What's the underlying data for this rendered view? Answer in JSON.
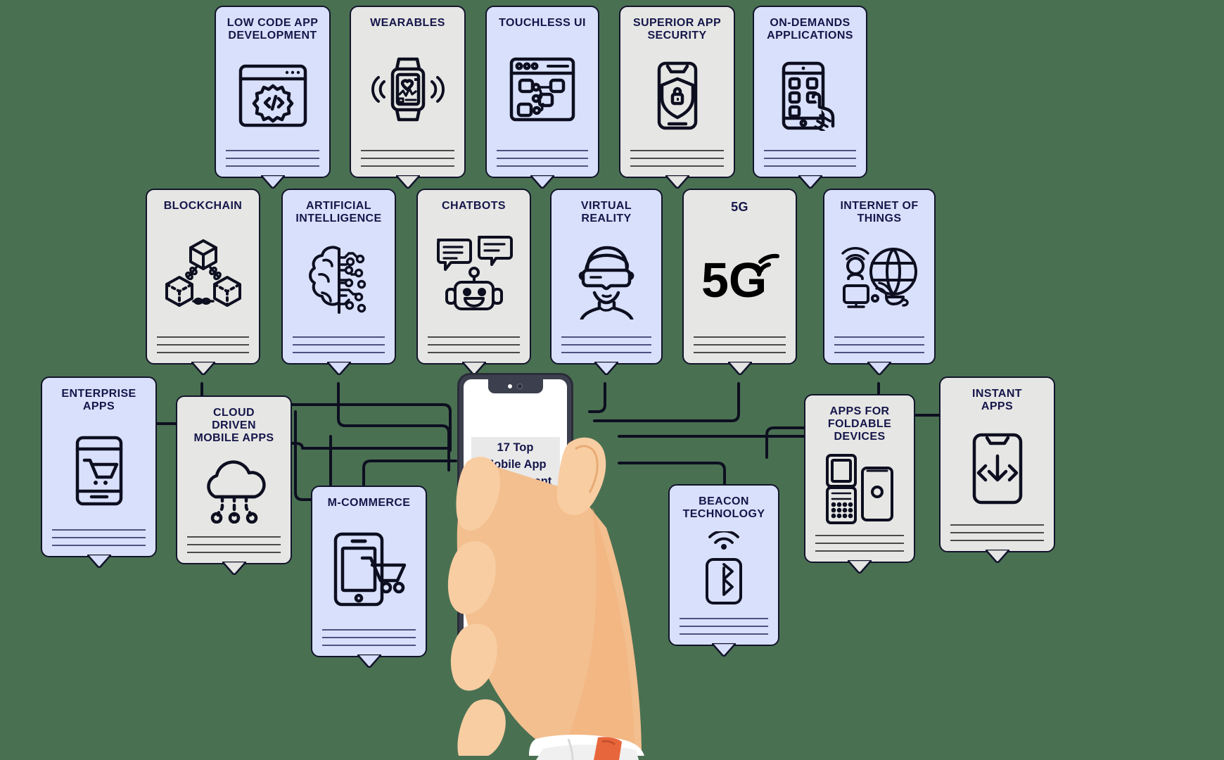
{
  "meta": {
    "background_color": "#4a7052",
    "card_blue": "#d9e0fb",
    "card_grey": "#e6e6e4",
    "title_color": "#15164a",
    "outline_color": "#12142b"
  },
  "phone": {
    "headline": "17 Top\nMobile App\nDevelopment\nTrends To\nLook Out For\nIn 2024"
  },
  "cards": [
    {
      "id": "low-code-app-development",
      "label": "LOW CODE APP\nDEVELOPMENT",
      "theme": "blue",
      "icon": "code-window-icon"
    },
    {
      "id": "wearables",
      "label": "WEARABLES",
      "theme": "grey",
      "icon": "smartwatch-icon"
    },
    {
      "id": "touchless-ui",
      "label": "TOUCHLESS UI",
      "theme": "blue",
      "icon": "flow-window-icon"
    },
    {
      "id": "superior-app-security",
      "label": "SUPERIOR APP\nSECURITY",
      "theme": "grey",
      "icon": "phone-shield-lock-icon"
    },
    {
      "id": "on-demands-applications",
      "label": "ON-DEMANDS\nAPPLICATIONS",
      "theme": "blue",
      "icon": "tap-phone-icon"
    },
    {
      "id": "blockchain",
      "label": "BLOCKCHAIN",
      "theme": "grey",
      "icon": "blockchain-cubes-icon"
    },
    {
      "id": "artificial-intelligence",
      "label": "ARTIFICIAL\nINTELLIGENCE",
      "theme": "blue",
      "icon": "brain-circuit-icon"
    },
    {
      "id": "chatbots",
      "label": "CHATBOTS",
      "theme": "grey",
      "icon": "robot-chat-icon"
    },
    {
      "id": "virtual-reality",
      "label": "VIRTUAL\nREALITY",
      "theme": "blue",
      "icon": "vr-headset-person-icon"
    },
    {
      "id": "5g",
      "label": "5G",
      "theme": "grey",
      "icon": "5g-signal-icon"
    },
    {
      "id": "internet-of-things",
      "label": "INTERNET OF\nTHINGS",
      "theme": "blue",
      "icon": "iot-globe-icon"
    },
    {
      "id": "enterprise-apps",
      "label": "ENTERPRISE\nAPPS",
      "theme": "blue",
      "icon": "phone-cart-icon"
    },
    {
      "id": "cloud-driven-mobile-apps",
      "label": "CLOUD\nDRIVEN\nMOBILE APPS",
      "theme": "grey",
      "icon": "cloud-nodes-icon"
    },
    {
      "id": "m-commerce",
      "label": "M-COMMERCE",
      "theme": "blue",
      "icon": "tablet-cart-icon"
    },
    {
      "id": "beacon-technology",
      "label": "BEACON\nTECHNOLOGY",
      "theme": "blue",
      "icon": "beacon-bluetooth-icon"
    },
    {
      "id": "apps-for-foldable-devices",
      "label": "APPS FOR\nFOLDABLE\nDEVICES",
      "theme": "grey",
      "icon": "foldable-phones-icon"
    },
    {
      "id": "instant-apps",
      "label": "INSTANT\nAPPS",
      "theme": "grey",
      "icon": "phone-download-icon"
    }
  ]
}
